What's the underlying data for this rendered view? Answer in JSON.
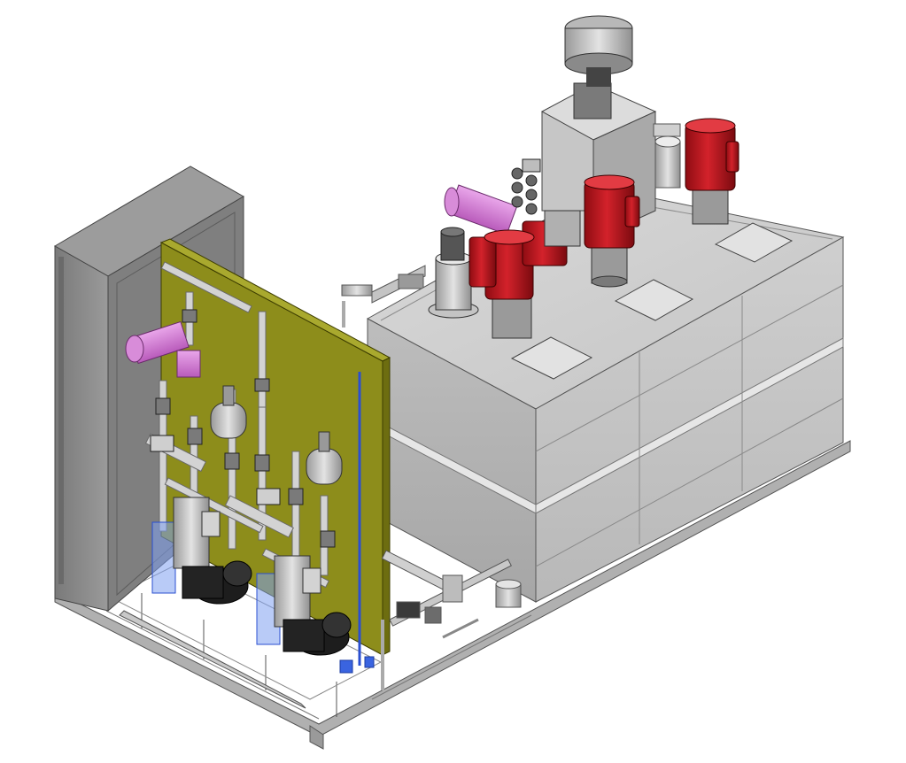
{
  "scene": {
    "kind": "isometric-cad-render",
    "subject": "skid-mounted-dosing-unit",
    "colors": {
      "background": "#ffffff",
      "tank": "#c9c9c9",
      "tank_shadow": "#a9a9a9",
      "frame": "#b5b5b5",
      "cabinet": "#8d8d8d",
      "panel": "#8a8a1c",
      "motor": "#c0141c",
      "inlet": "#d77ad8",
      "pipe": "#bfbfbf",
      "pump_body": "#1c1c1c",
      "filter_blue": "#6b8fe8"
    },
    "components": {
      "motor_count": 3,
      "dosing_pump_count": 2,
      "hatch_count": 3
    }
  }
}
